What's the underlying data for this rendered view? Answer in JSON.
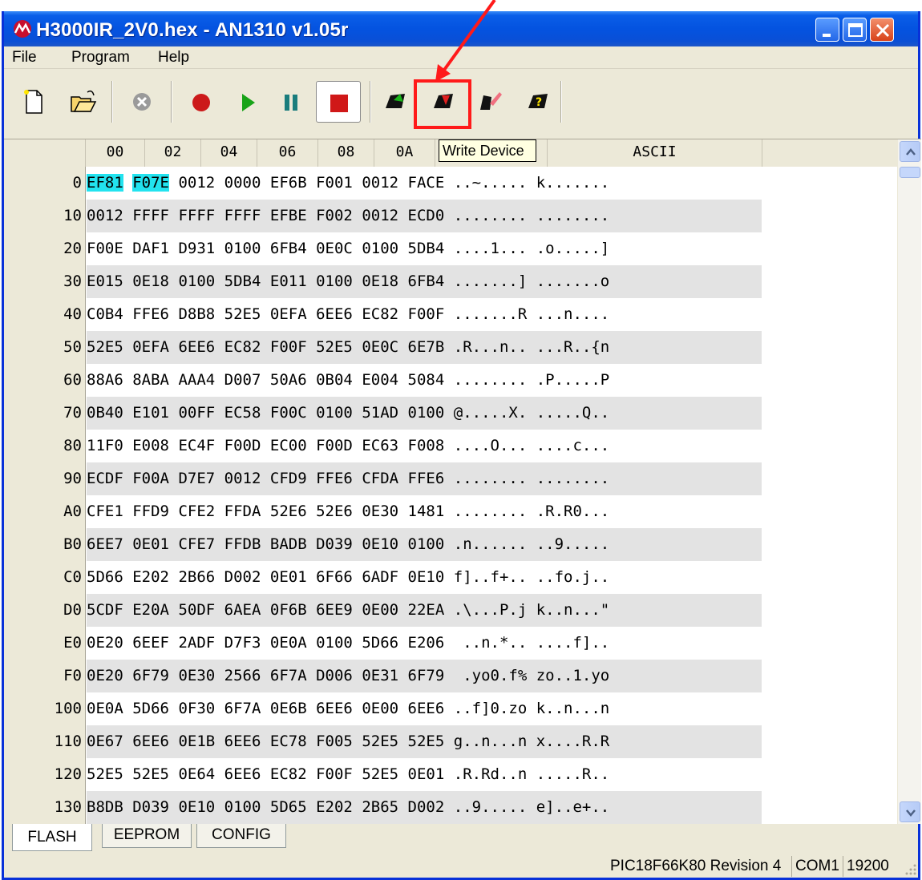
{
  "window": {
    "title": "H3000IR_2V0.hex - AN1310 v1.05r"
  },
  "menu": [
    {
      "label": "File"
    },
    {
      "label": "Program"
    },
    {
      "label": "Help"
    }
  ],
  "toolbar": {
    "buttons": [
      "new-file-icon",
      "open-folder-icon",
      "abort-icon",
      "record-icon",
      "run-icon",
      "pause-icon",
      "stop-icon",
      "read-device-icon",
      "write-device-icon",
      "erase-device-icon",
      "verify-device-icon"
    ],
    "tooltip": "Write Device",
    "highlight_color": "#ff1a1a"
  },
  "grid": {
    "headers": [
      "00",
      "02",
      "04",
      "06",
      "08",
      "0A",
      "ASCII"
    ],
    "rows": [
      {
        "addr": "0",
        "hex": [
          "EF81",
          "F07E",
          "0012",
          "0000",
          "EF6B",
          "F001",
          "0012",
          "FACE"
        ],
        "ascii": "..~..... k......."
      },
      {
        "addr": "10",
        "hex": [
          "0012",
          "FFFF",
          "FFFF",
          "FFFF",
          "EFBE",
          "F002",
          "0012",
          "ECD0"
        ],
        "ascii": "........ ........"
      },
      {
        "addr": "20",
        "hex": [
          "F00E",
          "DAF1",
          "D931",
          "0100",
          "6FB4",
          "0E0C",
          "0100",
          "5DB4"
        ],
        "ascii": "....1... .o.....]"
      },
      {
        "addr": "30",
        "hex": [
          "E015",
          "0E18",
          "0100",
          "5DB4",
          "E011",
          "0100",
          "0E18",
          "6FB4"
        ],
        "ascii": ".......] .......o"
      },
      {
        "addr": "40",
        "hex": [
          "C0B4",
          "FFE6",
          "D8B8",
          "52E5",
          "0EFA",
          "6EE6",
          "EC82",
          "F00F"
        ],
        "ascii": ".......R ...n...."
      },
      {
        "addr": "50",
        "hex": [
          "52E5",
          "0EFA",
          "6EE6",
          "EC82",
          "F00F",
          "52E5",
          "0E0C",
          "6E7B"
        ],
        "ascii": ".R...n.. ...R..{n"
      },
      {
        "addr": "60",
        "hex": [
          "88A6",
          "8ABA",
          "AAA4",
          "D007",
          "50A6",
          "0B04",
          "E004",
          "5084"
        ],
        "ascii": "........ .P.....P"
      },
      {
        "addr": "70",
        "hex": [
          "0B40",
          "E101",
          "00FF",
          "EC58",
          "F00C",
          "0100",
          "51AD",
          "0100"
        ],
        "ascii": "@.....X. .....Q.."
      },
      {
        "addr": "80",
        "hex": [
          "11F0",
          "E008",
          "EC4F",
          "F00D",
          "EC00",
          "F00D",
          "EC63",
          "F008"
        ],
        "ascii": "....O... ....c..."
      },
      {
        "addr": "90",
        "hex": [
          "ECDF",
          "F00A",
          "D7E7",
          "0012",
          "CFD9",
          "FFE6",
          "CFDA",
          "FFE6"
        ],
        "ascii": "........ ........"
      },
      {
        "addr": "A0",
        "hex": [
          "CFE1",
          "FFD9",
          "CFE2",
          "FFDA",
          "52E6",
          "52E6",
          "0E30",
          "1481"
        ],
        "ascii": "........ .R.R0..."
      },
      {
        "addr": "B0",
        "hex": [
          "6EE7",
          "0E01",
          "CFE7",
          "FFDB",
          "BADB",
          "D039",
          "0E10",
          "0100"
        ],
        "ascii": ".n...... ..9....."
      },
      {
        "addr": "C0",
        "hex": [
          "5D66",
          "E202",
          "2B66",
          "D002",
          "0E01",
          "6F66",
          "6ADF",
          "0E10"
        ],
        "ascii": "f]..f+.. ..fo.j.."
      },
      {
        "addr": "D0",
        "hex": [
          "5CDF",
          "E20A",
          "50DF",
          "6AEA",
          "0F6B",
          "6EE9",
          "0E00",
          "22EA"
        ],
        "ascii": ".\\...P.j k..n...\""
      },
      {
        "addr": "E0",
        "hex": [
          "0E20",
          "6EEF",
          "2ADF",
          "D7F3",
          "0E0A",
          "0100",
          "5D66",
          "E206"
        ],
        "ascii": " ..n.*.. ....f].."
      },
      {
        "addr": "F0",
        "hex": [
          "0E20",
          "6F79",
          "0E30",
          "2566",
          "6F7A",
          "D006",
          "0E31",
          "6F79"
        ],
        "ascii": " .yo0.f% zo..1.yo"
      },
      {
        "addr": "100",
        "hex": [
          "0E0A",
          "5D66",
          "0F30",
          "6F7A",
          "0E6B",
          "6EE6",
          "0E00",
          "6EE6"
        ],
        "ascii": "..f]0.zo k..n...n"
      },
      {
        "addr": "110",
        "hex": [
          "0E67",
          "6EE6",
          "0E1B",
          "6EE6",
          "EC78",
          "F005",
          "52E5",
          "52E5"
        ],
        "ascii": "g..n...n x....R.R"
      },
      {
        "addr": "120",
        "hex": [
          "52E5",
          "52E5",
          "0E64",
          "6EE6",
          "EC82",
          "F00F",
          "52E5",
          "0E01"
        ],
        "ascii": ".R.Rd..n .....R.."
      },
      {
        "addr": "130",
        "hex": [
          "B8DB",
          "D039",
          "0E10",
          "0100",
          "5D65",
          "E202",
          "2B65",
          "D002"
        ],
        "ascii": "..9..... e]..e+.."
      }
    ],
    "selected_color": "#22e3ef"
  },
  "tabs": [
    {
      "label": "FLASH",
      "active": true
    },
    {
      "label": "EEPROM",
      "active": false
    },
    {
      "label": "CONFIG",
      "active": false
    }
  ],
  "status": {
    "device": "PIC18F66K80 Revision 4",
    "port": "COM1",
    "baud": "19200"
  }
}
